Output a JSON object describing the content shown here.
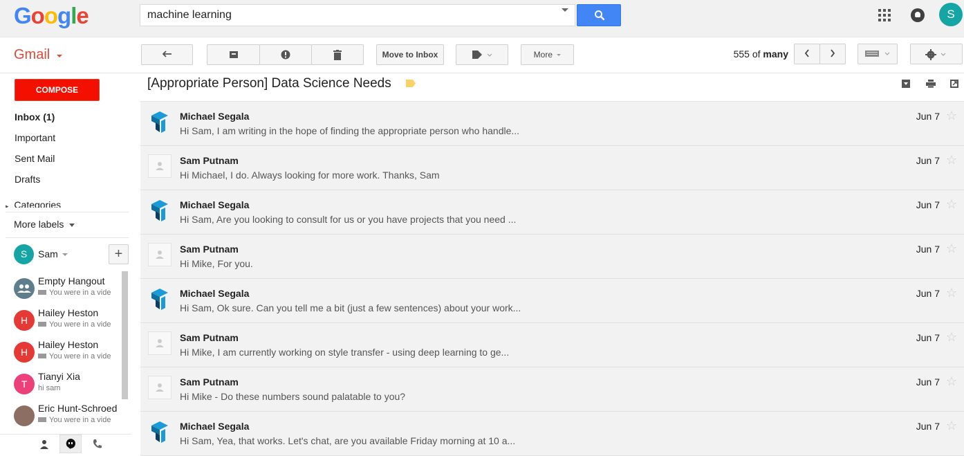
{
  "header": {
    "logo_letters": [
      {
        "ch": "G",
        "color": "#4285f4"
      },
      {
        "ch": "o",
        "color": "#ea4335"
      },
      {
        "ch": "o",
        "color": "#fbbc05"
      },
      {
        "ch": "g",
        "color": "#4285f4"
      },
      {
        "ch": "l",
        "color": "#34a853"
      },
      {
        "ch": "e",
        "color": "#ea4335"
      }
    ],
    "search_value": "machine learning",
    "account_initial": "S"
  },
  "toolbar": {
    "app_label": "Gmail",
    "move_to_inbox": "Move to Inbox",
    "more": "More",
    "page_range": "555",
    "page_of": "of",
    "page_total": "many"
  },
  "sidebar": {
    "compose": "COMPOSE",
    "items": [
      "Inbox (1)",
      "Important",
      "Sent Mail",
      "Drafts"
    ],
    "categories": "Categories",
    "more_labels": "More labels"
  },
  "hangouts": {
    "self_initial": "S",
    "self_name": "Sam",
    "add": "+",
    "contacts": [
      {
        "initial": "",
        "name": "Empty Hangout",
        "status": "You were in a vide",
        "color": "#607d8b",
        "icon": "group-icon"
      },
      {
        "initial": "H",
        "name": "Hailey Heston",
        "status": "You were in a vide",
        "color": "#e53935",
        "icon": "camera-icon"
      },
      {
        "initial": "H",
        "name": "Hailey Heston",
        "status": "You were in a vide",
        "color": "#e53935",
        "icon": "camera-icon"
      },
      {
        "initial": "T",
        "name": "Tianyi Xia",
        "status": "hi sam",
        "color": "#ec407a",
        "icon": ""
      },
      {
        "initial": "",
        "name": "Eric Hunt-Schroed",
        "status": "You were in a vide",
        "color": "#8d6e63",
        "icon": "camera-icon"
      }
    ]
  },
  "thread": {
    "title": "[Appropriate Person] Data Science Needs",
    "messages": [
      {
        "sender": "Michael Segala",
        "snippet": "Hi Sam, I am writing in the hope of finding the appropriate person who handle...",
        "date": "Jun 7",
        "avatar": "logo"
      },
      {
        "sender": "Sam Putnam",
        "snippet": "Hi Michael, I do. Always looking for more work. Thanks, Sam",
        "date": "Jun 7",
        "avatar": "placeholder"
      },
      {
        "sender": "Michael Segala",
        "snippet": "Hi Sam, Are you looking to consult for us or you have projects that you need ...",
        "date": "Jun 7",
        "avatar": "logo"
      },
      {
        "sender": "Sam Putnam",
        "snippet": "Hi Mike, For you.",
        "date": "Jun 7",
        "avatar": "placeholder"
      },
      {
        "sender": "Michael Segala",
        "snippet": "Hi Sam, Ok sure. Can you tell me a bit (just a few sentences) about your work...",
        "date": "Jun 7",
        "avatar": "logo"
      },
      {
        "sender": "Sam Putnam",
        "snippet": "Hi Mike, I am currently working on style transfer - using deep learning to ge...",
        "date": "Jun 7",
        "avatar": "placeholder"
      },
      {
        "sender": "Sam Putnam",
        "snippet": "Hi Mike - Do these numbers sound palatable to you?",
        "date": "Jun 7",
        "avatar": "placeholder"
      },
      {
        "sender": "Michael Segala",
        "snippet": "Hi Sam, Yea, that works. Let's chat, are you available Friday morning at 10 a...",
        "date": "Jun 7",
        "avatar": "logo"
      }
    ]
  },
  "colors": {
    "accent_red": "#dd4b39",
    "compose_red": "#f31000",
    "search_blue": "#4285f4",
    "label_yellow": "#fad165"
  }
}
